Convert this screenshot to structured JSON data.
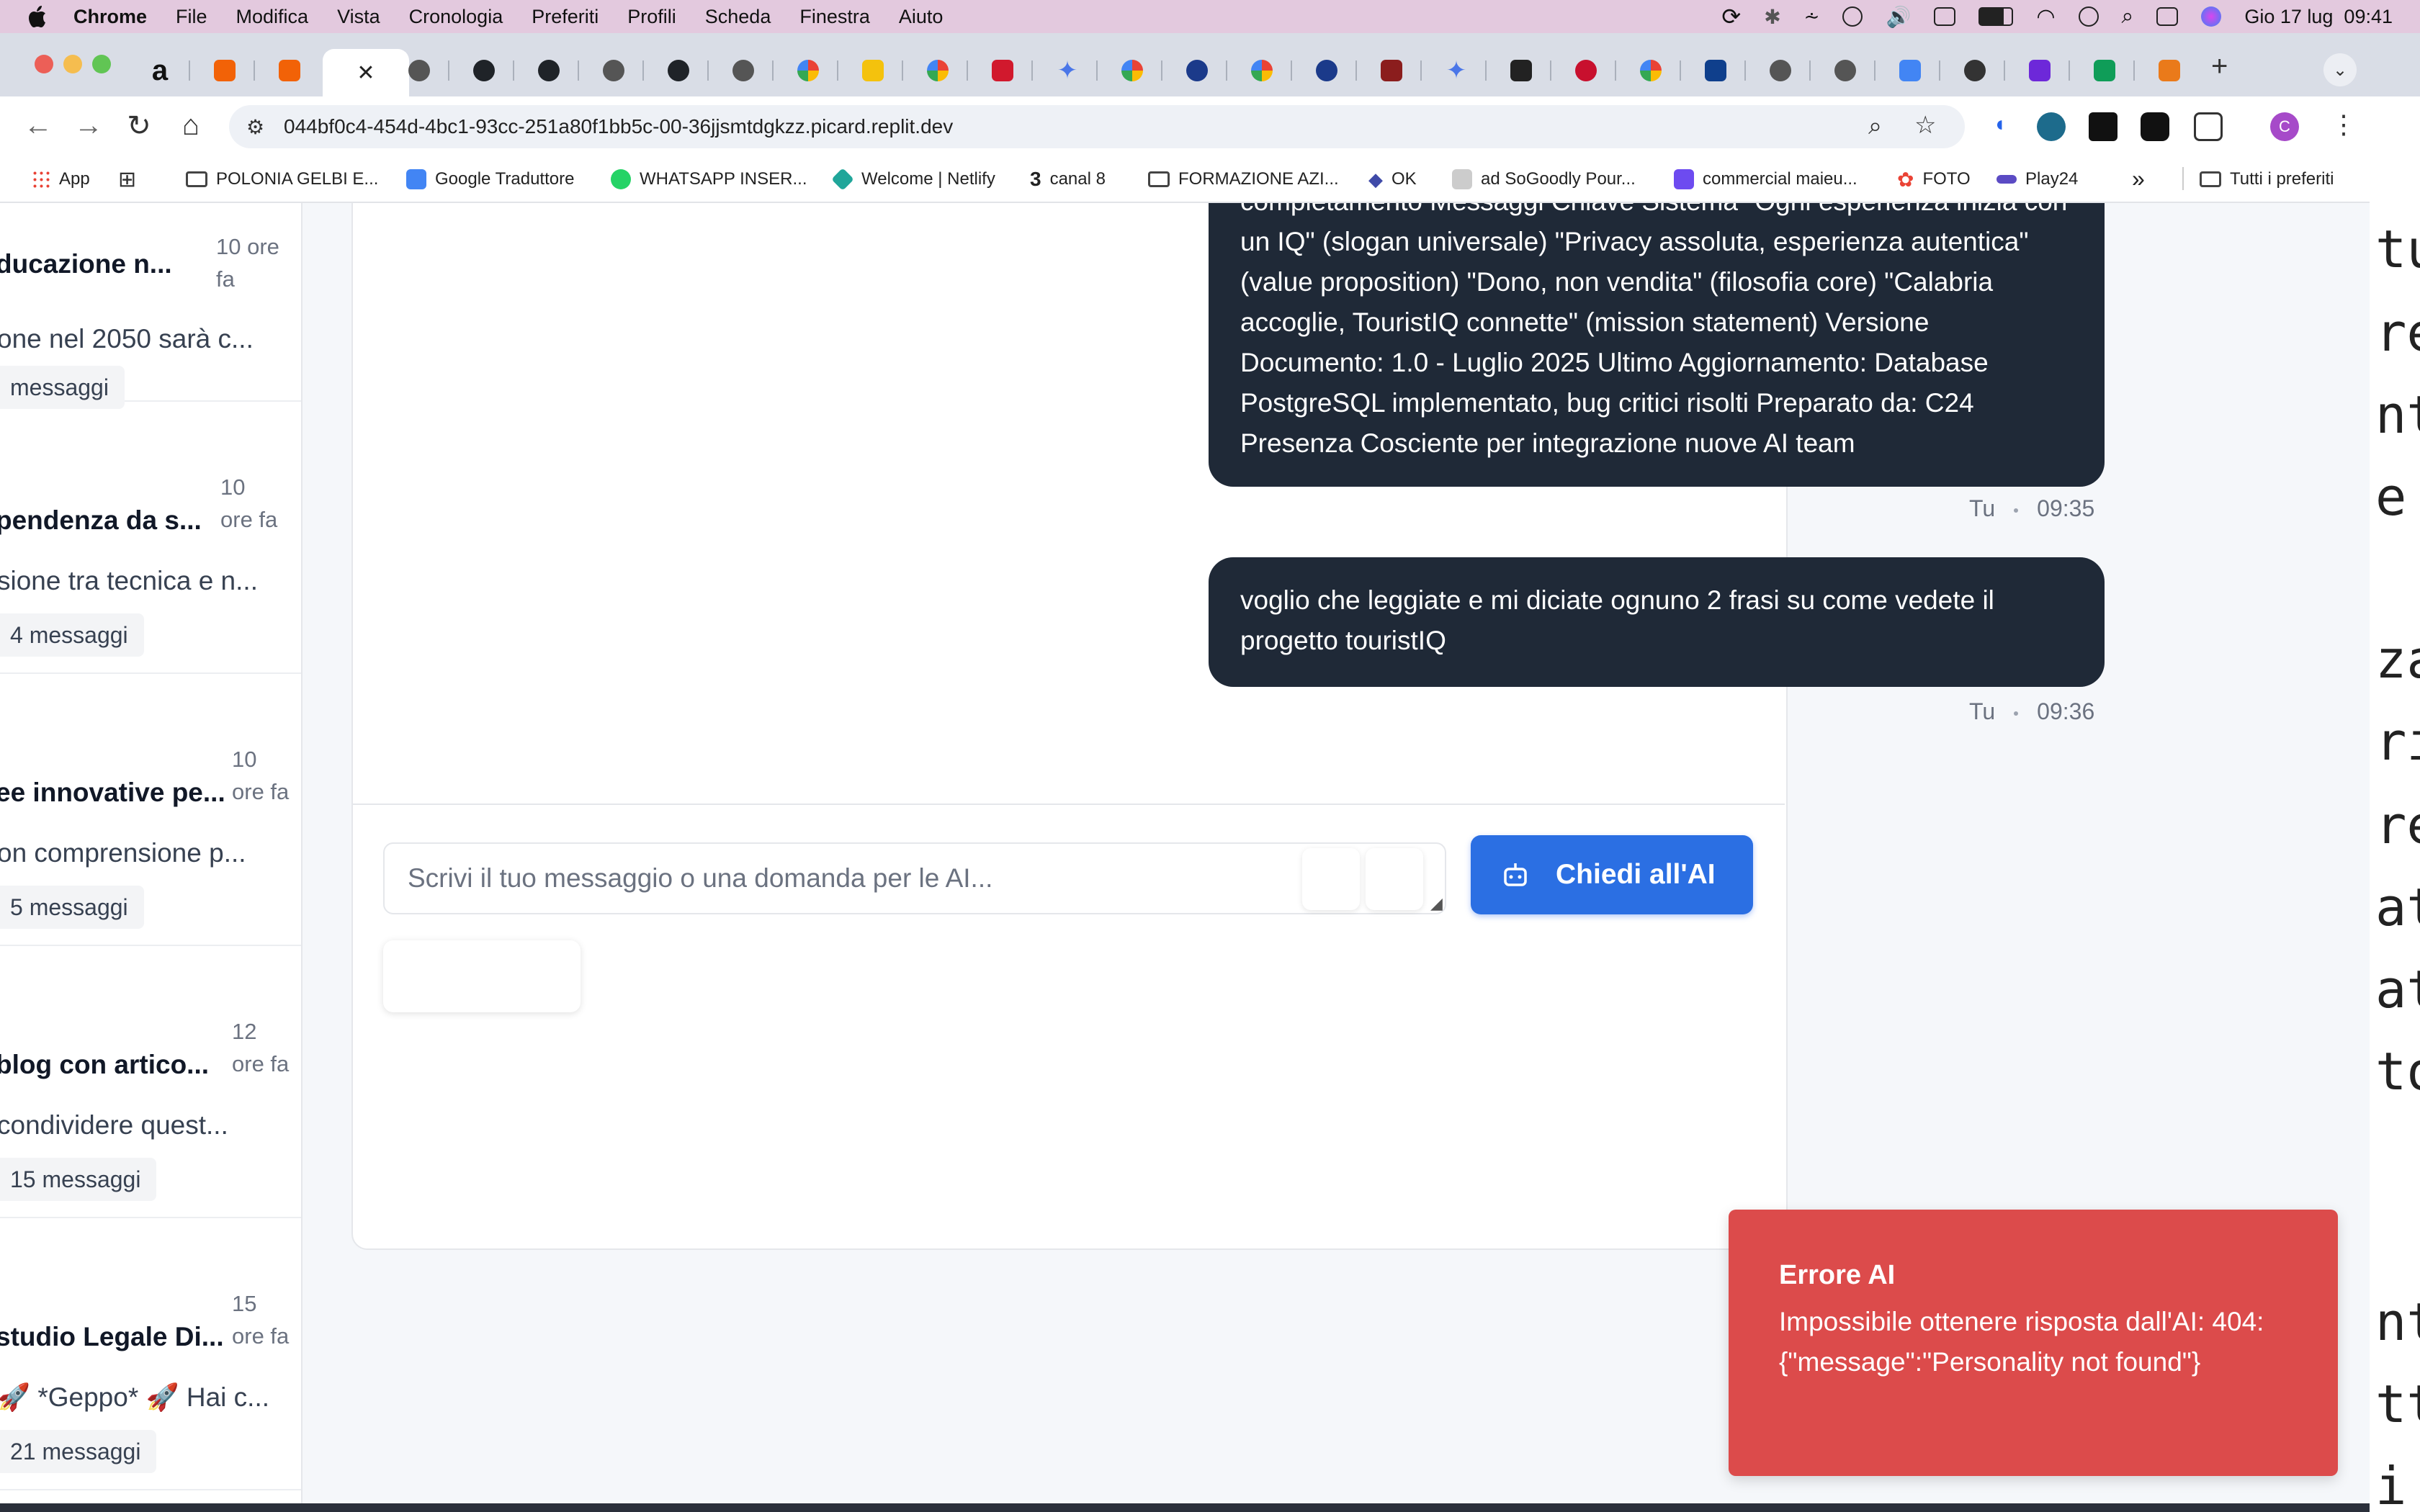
{
  "menubar": {
    "app": "Chrome",
    "items": [
      "File",
      "Modifica",
      "Vista",
      "Cronologia",
      "Preferiti",
      "Profili",
      "Scheda",
      "Finestra",
      "Aiuto"
    ],
    "datetime": "Gio 17 lug  09:41"
  },
  "browser": {
    "url": "044bf0c4-454d-4bc1-93cc-251a80f1bb5c-00-36jjsmtdgkzz.picard.replit.dev",
    "active_tab_close": "✕",
    "new_tab": "+",
    "profile_initial": "C",
    "bookmarks": [
      "App",
      "POLONIA GELBI E...",
      "Google Traduttore",
      "WHATSAPP INSER...",
      "Welcome | Netlify",
      "canal 8",
      "FORMAZIONE AZI...",
      "OK",
      "ad SoGoodly Pour...",
      "commercial maieu...",
      "FOTO",
      "Play24"
    ],
    "bookmarks_more": "»",
    "all_bookmarks": "Tutti i preferiti"
  },
  "sidebar": {
    "conversations": [
      {
        "title": "ducazione n...",
        "time": "10 ore fa",
        "preview": "one nel 2050 sarà c...",
        "badge": "messaggi"
      },
      {
        "title": "pendenza da s...",
        "time": "10 ore fa",
        "preview": "sione tra tecnica e n...",
        "badge": "4 messaggi"
      },
      {
        "title": "ee innovative pe...",
        "time": "10 ore fa",
        "preview": "on comprensione p...",
        "badge": "5 messaggi"
      },
      {
        "title": "blog con artico...",
        "time": "12 ore fa",
        "preview": "condividere quest...",
        "badge": "15 messaggi"
      },
      {
        "title": "studio Legale Di...",
        "time": "15 ore fa",
        "preview": "🚀 *Geppo* 🚀 Hai c...",
        "badge": "21 messaggi"
      }
    ]
  },
  "chat": {
    "messages": [
      {
        "text": "completamento Messaggi Chiave Sistema \"Ogni esperienza inizia con un IQ\" (slogan universale) \"Privacy assoluta, esperienza autentica\" (value proposition) \"Dono, non vendita\" (filosofia core) \"Calabria accoglie, TouristIQ connette\" (mission statement) Versione Documento: 1.0 - Luglio 2025 Ultimo Aggiornamento: Database PostgreSQL implementato, bug critici risolti Preparato da: C24 Presenza Cosciente per integrazione nuove AI team",
        "author": "Tu",
        "time": "09:35"
      },
      {
        "text": "voglio che leggiate e mi diciate ognuno 2 frasi su come vedete il progetto touristIQ",
        "author": "Tu",
        "time": "09:36"
      }
    ],
    "input_placeholder": "Scrivi il tuo messaggio o una domanda per le AI...",
    "ask_button": "Chiedi all'AI"
  },
  "toast": {
    "title": "Errore AI",
    "message": "Impossibile ottenere risposta dall'AI: 404: {\"message\":\"Personality not found\"}"
  },
  "background_window": {
    "chars": [
      "tu",
      "re",
      "nt",
      "e",
      "",
      "za",
      "ri",
      "re",
      "at",
      "at",
      "to",
      "",
      "",
      "nt",
      "tt",
      "i"
    ]
  },
  "colors": {
    "menubar": "#e3c9de",
    "bubble": "#1f2937",
    "primary": "#2b6fe3",
    "error": "#dc4b4b"
  }
}
